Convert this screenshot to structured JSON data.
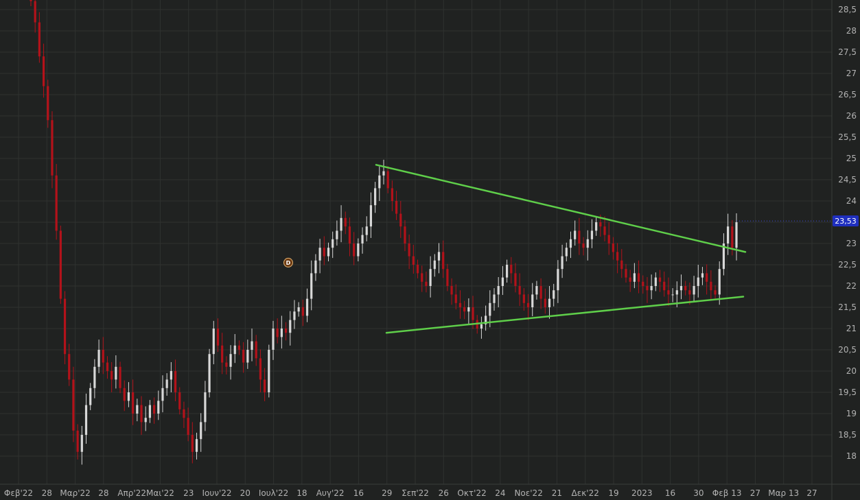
{
  "chart_data": {
    "type": "candlestick",
    "y_ticks": [
      "28,5",
      "28",
      "27,5",
      "27",
      "26,5",
      "26",
      "25,5",
      "25",
      "24,5",
      "24",
      "23,5",
      "23",
      "22,5",
      "22",
      "21,5",
      "21",
      "20,5",
      "20",
      "19,5",
      "19",
      "18,5",
      "18"
    ],
    "y_tick_values": [
      28.5,
      28,
      27.5,
      27,
      26.5,
      26,
      25.5,
      25,
      24.5,
      24,
      23.5,
      23,
      22.5,
      22,
      21.5,
      21,
      20.5,
      20,
      19.5,
      19,
      18.5,
      18
    ],
    "ylim": [
      17.35,
      28.75
    ],
    "x_ticks": [
      "Φεβ'22",
      "28",
      "Μαρ'22",
      "28",
      "Απρ'22",
      "Μαι'22",
      "23",
      "Ιουν'22",
      "20",
      "Ιουλ'22",
      "18",
      "Αυγ'22",
      "16",
      "29",
      "Σεπ'22",
      "26",
      "Οκτ'22",
      "24",
      "Νοε'22",
      "21",
      "Δεκ'22",
      "19",
      "2023",
      "16",
      "30",
      "Φεβ 13",
      "27",
      "Μαρ 13",
      "27"
    ],
    "last_price": 23.53,
    "last_price_label": "23,53",
    "event_marker": {
      "label": "D",
      "value": 22.55
    },
    "trendlines": [
      {
        "name": "upper",
        "start": 24.85,
        "end": 22.8
      },
      {
        "name": "lower",
        "start": 20.9,
        "end": 21.75
      }
    ],
    "closes": [
      28.7,
      28.2,
      27.4,
      26.7,
      25.9,
      24.6,
      23.3,
      21.7,
      20.4,
      19.8,
      18.6,
      18.1,
      18.5,
      19.2,
      19.6,
      20.1,
      20.5,
      20.2,
      20.0,
      19.8,
      20.1,
      19.6,
      19.3,
      19.5,
      19.0,
      19.2,
      18.8,
      18.9,
      19.2,
      19.0,
      19.3,
      19.6,
      19.8,
      20.0,
      19.5,
      19.1,
      18.9,
      18.5,
      18.1,
      18.4,
      18.8,
      19.5,
      20.4,
      21.0,
      20.6,
      20.2,
      20.1,
      20.4,
      20.6,
      20.5,
      20.2,
      20.5,
      20.7,
      20.3,
      19.8,
      19.5,
      20.5,
      21.0,
      20.8,
      21.0,
      20.9,
      21.2,
      21.4,
      21.5,
      21.3,
      21.7,
      22.3,
      22.6,
      22.9,
      22.7,
      22.9,
      23.1,
      23.3,
      23.6,
      23.4,
      23.0,
      22.7,
      23.0,
      23.2,
      23.4,
      23.9,
      24.3,
      24.6,
      24.7,
      24.3,
      24.0,
      23.7,
      23.4,
      23.0,
      22.7,
      22.5,
      22.3,
      22.1,
      22.0,
      22.4,
      22.6,
      22.8,
      22.4,
      22.0,
      21.8,
      21.6,
      21.5,
      21.4,
      21.5,
      21.2,
      21.0,
      21.1,
      21.3,
      21.6,
      21.8,
      22.0,
      22.2,
      22.5,
      22.3,
      22.0,
      21.8,
      21.6,
      21.5,
      21.8,
      22.0,
      21.7,
      21.5,
      21.7,
      21.9,
      22.4,
      22.7,
      22.9,
      23.1,
      23.3,
      23.0,
      22.9,
      23.1,
      23.3,
      23.5,
      23.4,
      23.2,
      23.0,
      22.8,
      22.6,
      22.4,
      22.2,
      22.1,
      22.3,
      22.1,
      22.0,
      21.9,
      22.0,
      22.2,
      22.1,
      21.9,
      21.8,
      21.8,
      21.9,
      22.0,
      21.9,
      21.8,
      22.0,
      22.2,
      22.3,
      22.1,
      21.9,
      21.8,
      22.4,
      23.0,
      23.4,
      22.9,
      23.5
    ]
  }
}
